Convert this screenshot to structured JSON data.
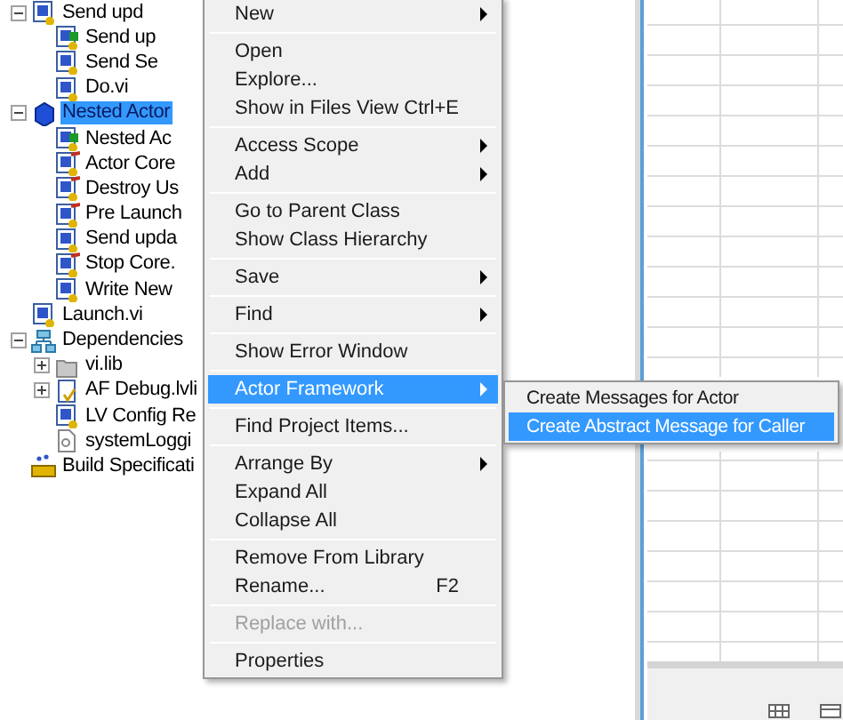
{
  "tree": [
    {
      "label": "Send upd",
      "kind": "vi",
      "expanded": true,
      "children": [
        {
          "label": "Send up",
          "kind": "vi-locked"
        },
        {
          "label": "Send Se",
          "kind": "vi"
        },
        {
          "label": "Do.vi",
          "kind": "vi"
        }
      ]
    },
    {
      "label": "Nested Actor",
      "kind": "class",
      "selected": true,
      "expanded": true,
      "children": [
        {
          "label": "Nested Ac",
          "kind": "vi-locked"
        },
        {
          "label": "Actor Core",
          "kind": "vi-override"
        },
        {
          "label": "Destroy Us",
          "kind": "vi-override"
        },
        {
          "label": "Pre Launch",
          "kind": "vi-override"
        },
        {
          "label": "Send upda",
          "kind": "vi"
        },
        {
          "label": "Stop Core.",
          "kind": "vi-override"
        },
        {
          "label": "Write New",
          "kind": "vi"
        }
      ]
    },
    {
      "label": "Launch.vi",
      "kind": "vi"
    },
    {
      "label": "Dependencies",
      "kind": "deps",
      "expanded": true,
      "children": [
        {
          "label": "vi.lib",
          "kind": "folder",
          "expanded": false
        },
        {
          "label": "AF Debug.lvli",
          "kind": "library",
          "expanded": false
        },
        {
          "label": "LV Config Re",
          "kind": "vi"
        },
        {
          "label": "systemLoggi",
          "kind": "file"
        }
      ]
    },
    {
      "label": "Build Specificati",
      "kind": "build"
    }
  ],
  "context_menu": [
    [
      {
        "label": "New",
        "submenu": true,
        "selected": false,
        "disabled": false
      }
    ],
    [
      {
        "label": "Open",
        "selected": false,
        "disabled": false
      },
      {
        "label": "Explore...",
        "selected": false,
        "disabled": false
      },
      {
        "label": "Show in Files View",
        "shortcut": "Ctrl+E",
        "selected": false,
        "disabled": false
      }
    ],
    [
      {
        "label": "Access Scope",
        "submenu": true,
        "selected": false,
        "disabled": false
      },
      {
        "label": "Add",
        "submenu": true,
        "selected": false,
        "disabled": false
      }
    ],
    [
      {
        "label": "Go to Parent Class",
        "selected": false,
        "disabled": false
      },
      {
        "label": "Show Class Hierarchy",
        "selected": false,
        "disabled": false
      }
    ],
    [
      {
        "label": "Save",
        "submenu": true,
        "selected": false,
        "disabled": false
      }
    ],
    [
      {
        "label": "Find",
        "submenu": true,
        "selected": false,
        "disabled": false
      }
    ],
    [
      {
        "label": "Show Error Window",
        "selected": false,
        "disabled": false
      }
    ],
    [
      {
        "label": "Actor Framework",
        "submenu": true,
        "selected": true,
        "disabled": false
      }
    ],
    [
      {
        "label": "Find Project Items...",
        "selected": false,
        "disabled": false
      }
    ],
    [
      {
        "label": "Arrange By",
        "submenu": true,
        "selected": false,
        "disabled": false
      },
      {
        "label": "Expand All",
        "selected": false,
        "disabled": false
      },
      {
        "label": "Collapse All",
        "selected": false,
        "disabled": false
      }
    ],
    [
      {
        "label": "Remove From Library",
        "selected": false,
        "disabled": false
      },
      {
        "label": "Rename...",
        "shortcut": "F2",
        "selected": false,
        "disabled": false
      }
    ],
    [
      {
        "label": "Replace with...",
        "selected": false,
        "disabled": true
      }
    ],
    [
      {
        "label": "Properties",
        "selected": false,
        "disabled": false
      }
    ]
  ],
  "submenu": [
    {
      "label": "Create Messages for Actor",
      "selected": false
    },
    {
      "label": "Create Abstract Message for Caller",
      "selected": true
    }
  ]
}
